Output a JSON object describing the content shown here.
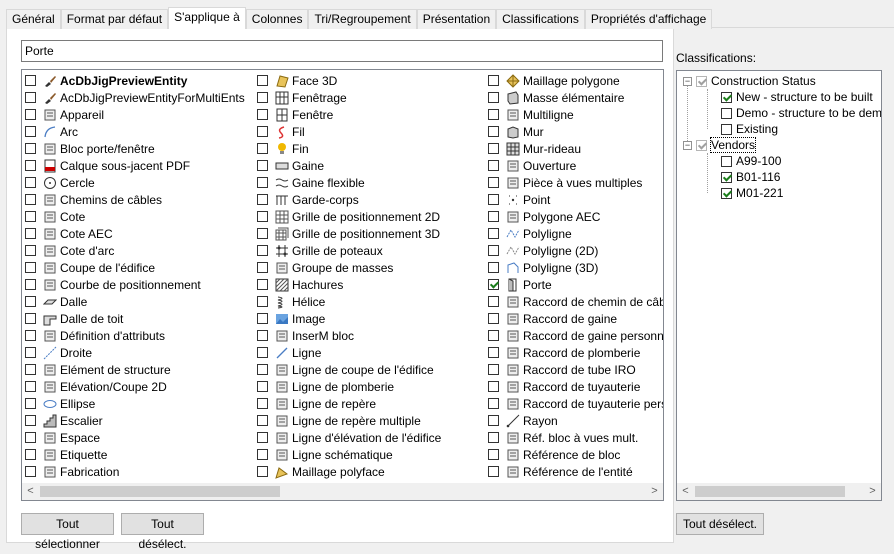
{
  "tabs": [
    {
      "label": "Général"
    },
    {
      "label": "Format par défaut"
    },
    {
      "label": "S'applique à"
    },
    {
      "label": "Colonnes"
    },
    {
      "label": "Tri/Regroupement"
    },
    {
      "label": "Présentation"
    },
    {
      "label": "Classifications"
    },
    {
      "label": "Propriétés d'affichage"
    }
  ],
  "active_tab": "S'applique à",
  "search": {
    "value": "Porte"
  },
  "objects": {
    "col1": [
      {
        "label": "AcDbJigPreviewEntity",
        "checked": false,
        "icon": "brush-icon",
        "bold": true
      },
      {
        "label": "AcDbJigPreviewEntityForMultiEnts",
        "checked": false,
        "icon": "brush-icon",
        "bold": false
      },
      {
        "label": "Appareil",
        "checked": false,
        "icon": "appliance-icon",
        "bold": false
      },
      {
        "label": "Arc",
        "checked": false,
        "icon": "arc-icon",
        "bold": false
      },
      {
        "label": "Bloc porte/fenêtre",
        "checked": false,
        "icon": "door-window-icon",
        "bold": false
      },
      {
        "label": "Calque sous-jacent PDF",
        "checked": false,
        "icon": "pdf-icon",
        "bold": false
      },
      {
        "label": "Cercle",
        "checked": false,
        "icon": "circle-icon",
        "bold": false
      },
      {
        "label": "Chemins de câbles",
        "checked": false,
        "icon": "cable-tray-icon",
        "bold": false
      },
      {
        "label": "Cote",
        "checked": false,
        "icon": "dimension-icon",
        "bold": false
      },
      {
        "label": "Cote AEC",
        "checked": false,
        "icon": "aec-dimension-icon",
        "bold": false
      },
      {
        "label": "Cote d'arc",
        "checked": false,
        "icon": "arc-dimension-icon",
        "bold": false
      },
      {
        "label": "Coupe de l'édifice",
        "checked": false,
        "icon": "building-section-icon",
        "bold": false
      },
      {
        "label": "Courbe de positionnement",
        "checked": false,
        "icon": "curve-icon",
        "bold": false
      },
      {
        "label": "Dalle",
        "checked": false,
        "icon": "slab-icon",
        "bold": false
      },
      {
        "label": "Dalle de toit",
        "checked": false,
        "icon": "roof-slab-icon",
        "bold": false
      },
      {
        "label": "Définition d'attributs",
        "checked": false,
        "icon": "attribute-icon",
        "bold": false
      },
      {
        "label": "Droite",
        "checked": false,
        "icon": "xline-icon",
        "bold": false
      },
      {
        "label": "Elément de structure",
        "checked": false,
        "icon": "structure-icon",
        "bold": false
      },
      {
        "label": "Elévation/Coupe 2D",
        "checked": false,
        "icon": "elevation-icon",
        "bold": false
      },
      {
        "label": "Ellipse",
        "checked": false,
        "icon": "ellipse-icon",
        "bold": false
      },
      {
        "label": "Escalier",
        "checked": false,
        "icon": "stair-icon",
        "bold": false
      },
      {
        "label": "Espace",
        "checked": false,
        "icon": "space-icon",
        "bold": false
      },
      {
        "label": "Etiquette",
        "checked": false,
        "icon": "label-icon",
        "bold": false
      },
      {
        "label": "Fabrication",
        "checked": false,
        "icon": "fabrication-icon",
        "bold": false
      }
    ],
    "col2": [
      {
        "label": "Face 3D",
        "checked": false,
        "icon": "face3d-icon",
        "bold": false
      },
      {
        "label": "Fenêtrage",
        "checked": false,
        "icon": "window-assembly-icon",
        "bold": false
      },
      {
        "label": "Fenêtre",
        "checked": false,
        "icon": "window-icon",
        "bold": false
      },
      {
        "label": "Fil",
        "checked": false,
        "icon": "wire-icon",
        "bold": false
      },
      {
        "label": "Fin",
        "checked": false,
        "icon": "bulb-icon",
        "bold": false
      },
      {
        "label": "Gaine",
        "checked": false,
        "icon": "duct-icon",
        "bold": false
      },
      {
        "label": "Gaine flexible",
        "checked": false,
        "icon": "flex-duct-icon",
        "bold": false
      },
      {
        "label": "Garde-corps",
        "checked": false,
        "icon": "railing-icon",
        "bold": false
      },
      {
        "label": "Grille de positionnement 2D",
        "checked": false,
        "icon": "grid-icon",
        "bold": false
      },
      {
        "label": "Grille de positionnement 3D",
        "checked": false,
        "icon": "grid3d-icon",
        "bold": false
      },
      {
        "label": "Grille de poteaux",
        "checked": false,
        "icon": "column-grid-icon",
        "bold": false
      },
      {
        "label": "Groupe de masses",
        "checked": false,
        "icon": "mass-group-icon",
        "bold": false
      },
      {
        "label": "Hachures",
        "checked": false,
        "icon": "hatch-icon",
        "bold": false
      },
      {
        "label": "Hélice",
        "checked": false,
        "icon": "helix-icon",
        "bold": false
      },
      {
        "label": "Image",
        "checked": false,
        "icon": "image-icon",
        "bold": false
      },
      {
        "label": "InserM bloc",
        "checked": false,
        "icon": "minsert-icon",
        "bold": false
      },
      {
        "label": "Ligne",
        "checked": false,
        "icon": "line-icon",
        "bold": false
      },
      {
        "label": "Ligne de coupe de l'édifice",
        "checked": false,
        "icon": "section-line-icon",
        "bold": false
      },
      {
        "label": "Ligne de plomberie",
        "checked": false,
        "icon": "plumbing-line-icon",
        "bold": false
      },
      {
        "label": "Ligne de repère",
        "checked": false,
        "icon": "leader-icon",
        "bold": false
      },
      {
        "label": "Ligne de repère multiple",
        "checked": false,
        "icon": "multileader-icon",
        "bold": false
      },
      {
        "label": "Ligne d'élévation de l'édifice",
        "checked": false,
        "icon": "elevation-line-icon",
        "bold": false
      },
      {
        "label": "Ligne schématique",
        "checked": false,
        "icon": "schematic-line-icon",
        "bold": false
      },
      {
        "label": "Maillage polyface",
        "checked": false,
        "icon": "polyface-icon",
        "bold": false
      }
    ],
    "col3": [
      {
        "label": "Maillage polygone",
        "checked": false,
        "icon": "polygon-mesh-icon",
        "bold": false
      },
      {
        "label": "Masse élémentaire",
        "checked": false,
        "icon": "mass-element-icon",
        "bold": false
      },
      {
        "label": "Multiligne",
        "checked": false,
        "icon": "mline-icon",
        "bold": false
      },
      {
        "label": "Mur",
        "checked": false,
        "icon": "wall-icon",
        "bold": false
      },
      {
        "label": "Mur-rideau",
        "checked": false,
        "icon": "curtain-wall-icon",
        "bold": false
      },
      {
        "label": "Ouverture",
        "checked": false,
        "icon": "opening-icon",
        "bold": false
      },
      {
        "label": "Pièce à vues multiples",
        "checked": false,
        "icon": "mvpart-icon",
        "bold": false
      },
      {
        "label": "Point",
        "checked": false,
        "icon": "point-icon",
        "bold": false
      },
      {
        "label": "Polygone AEC",
        "checked": false,
        "icon": "aec-polygon-icon",
        "bold": false
      },
      {
        "label": "Polyligne",
        "checked": false,
        "icon": "polyline-icon",
        "bold": false
      },
      {
        "label": "Polyligne (2D)",
        "checked": false,
        "icon": "polyline2d-icon",
        "bold": false
      },
      {
        "label": "Polyligne (3D)",
        "checked": false,
        "icon": "polyline3d-icon",
        "bold": false
      },
      {
        "label": "Porte",
        "checked": true,
        "icon": "door-icon",
        "bold": false
      },
      {
        "label": "Raccord de chemin de câbles",
        "checked": false,
        "icon": "cable-fitting-icon",
        "bold": false
      },
      {
        "label": "Raccord de gaine",
        "checked": false,
        "icon": "duct-fitting-icon",
        "bold": false
      },
      {
        "label": "Raccord de gaine personnalisé",
        "checked": false,
        "icon": "custom-duct-fitting-icon",
        "bold": false
      },
      {
        "label": "Raccord de plomberie",
        "checked": false,
        "icon": "plumbing-fitting-icon",
        "bold": false
      },
      {
        "label": "Raccord de tube IRO",
        "checked": false,
        "icon": "conduit-fitting-icon",
        "bold": false
      },
      {
        "label": "Raccord de tuyauterie",
        "checked": false,
        "icon": "pipe-fitting-icon",
        "bold": false
      },
      {
        "label": "Raccord de tuyauterie personnalisé",
        "checked": false,
        "icon": "custom-pipe-fitting-icon",
        "bold": false
      },
      {
        "label": "Rayon",
        "checked": false,
        "icon": "ray-icon",
        "bold": false
      },
      {
        "label": "Réf. bloc à vues mult.",
        "checked": false,
        "icon": "mvblock-ref-icon",
        "bold": false
      },
      {
        "label": "Référence de bloc",
        "checked": false,
        "icon": "block-ref-icon",
        "bold": false
      },
      {
        "label": "Référence de l'entité",
        "checked": false,
        "icon": "entity-ref-icon",
        "bold": false
      }
    ]
  },
  "buttons": {
    "select_all": "Tout sélectionner",
    "deselect_all": "Tout désélect.",
    "deselect_all_classif": "Tout désélect."
  },
  "classifications": {
    "label": "Classifications:",
    "groups": [
      {
        "label": "Construction Status",
        "checked": true,
        "children": [
          {
            "label": "New - structure to be built",
            "checked": true
          },
          {
            "label": "Demo - structure to be demolished",
            "checked": false
          },
          {
            "label": "Existing",
            "checked": false
          }
        ]
      },
      {
        "label": "Vendors",
        "checked": true,
        "children": [
          {
            "label": "A99-100",
            "checked": false
          },
          {
            "label": "B01-116",
            "checked": true
          },
          {
            "label": "M01-221",
            "checked": true
          }
        ]
      }
    ]
  },
  "colors": {
    "accent": "#0078d7",
    "check": "#1a7d1a"
  }
}
